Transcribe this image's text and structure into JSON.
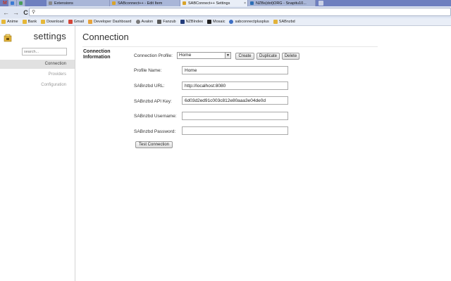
{
  "browser": {
    "tabs": [
      {
        "title": "Extensions"
      },
      {
        "title": "SABconnect++ - Edit Item"
      },
      {
        "title": "SABConnect++ Settings"
      },
      {
        "title": "NZBs(dot)ORG - Snapitu10..."
      }
    ],
    "bookmarks": [
      {
        "label": "Anime",
        "icon": "folder-icon"
      },
      {
        "label": "Bank",
        "icon": "folder-icon"
      },
      {
        "label": "Download",
        "icon": "folder-icon"
      },
      {
        "label": "Gmail",
        "icon": "gmail-icon"
      },
      {
        "label": "Developer Dashboard",
        "icon": "dashboard-icon"
      },
      {
        "label": "Avalon",
        "icon": "avalon-icon"
      },
      {
        "label": "Fanzub",
        "icon": "fanzub-icon"
      },
      {
        "label": "NZBIndex",
        "icon": "nzbindex-icon"
      },
      {
        "label": "Mosaic",
        "icon": "mosaic-icon"
      },
      {
        "label": "sabconnectplusplus",
        "icon": "sabconnect-icon"
      },
      {
        "label": "SABnzbd",
        "icon": "sabnzbd-icon"
      }
    ]
  },
  "sidebar": {
    "title": "settings",
    "search_placeholder": "search...",
    "items": [
      {
        "label": "Connection",
        "active": true
      },
      {
        "label": "Providers",
        "active": false
      },
      {
        "label": "Configuration",
        "active": false
      }
    ]
  },
  "main": {
    "title": "Connection",
    "section_heading": "Connection Information",
    "profile_label": "Connection Profile:",
    "profile_selected": "Home",
    "buttons": {
      "create": "Create",
      "duplicate": "Duplicate",
      "delete": "Delete",
      "test": "Test Connection"
    },
    "fields": {
      "profile_name": {
        "label": "Profile Name:",
        "value": "Home"
      },
      "url": {
        "label": "SABnzbd URL:",
        "value": "http://localhost:8080"
      },
      "api_key": {
        "label": "SABnzbd API Key:",
        "value": "6d03d2ed91c003c812e80aaa3e04de0d"
      },
      "username": {
        "label": "SABnzbd Username:",
        "value": ""
      },
      "password": {
        "label": "SABnzbd Password:",
        "value": ""
      }
    }
  },
  "colors": {
    "tabstrip": "#6e7fbf",
    "toolbar": "#dfe6f3",
    "nav_active": "#e1e1e1"
  }
}
